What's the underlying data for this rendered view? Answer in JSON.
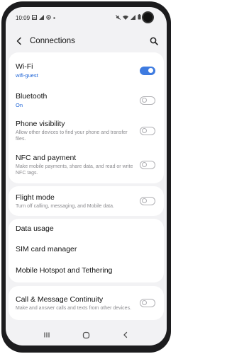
{
  "status_bar": {
    "time": "10:09",
    "left_icons": [
      "image-notification-icon",
      "signal-strength-icon",
      "settings-notification-icon",
      "more-notifications-icon"
    ],
    "right_icons": [
      "mute-icon",
      "wifi-icon",
      "signal-strength-icon",
      "battery-icon"
    ]
  },
  "header": {
    "title": "Connections"
  },
  "groups": [
    {
      "items": [
        {
          "title": "Wi-Fi",
          "status": "wifi-guest",
          "toggle": true,
          "toggle_on": true
        },
        {
          "title": "Bluetooth",
          "status": "On",
          "toggle": true,
          "toggle_on": false
        },
        {
          "title": "Phone visibility",
          "subtitle": "Allow other devices to find your phone and transfer files.",
          "toggle": true,
          "toggle_on": false
        },
        {
          "title": "NFC and payment",
          "subtitle": "Make mobile payments, share data, and read or write NFC tags.",
          "toggle": true,
          "toggle_on": false
        }
      ]
    },
    {
      "items": [
        {
          "title": "Flight mode",
          "subtitle": "Turn off calling, messaging, and Mobile data.",
          "toggle": true,
          "toggle_on": false
        }
      ]
    },
    {
      "items": [
        {
          "title": "Data usage"
        },
        {
          "title": "SIM card manager"
        },
        {
          "title": "Mobile Hotspot and Tethering"
        }
      ]
    },
    {
      "items": [
        {
          "title": "Call & Message Continuity",
          "subtitle": "Make and answer calls and texts from other devices.",
          "toggle": true,
          "toggle_on": false
        }
      ]
    }
  ],
  "nav_bar": {
    "icons": [
      "recent-apps-icon",
      "home-icon",
      "back-icon"
    ]
  },
  "colors": {
    "accent": "#3e7be0",
    "status_text": "#1b62d6",
    "background": "#f2f2f4"
  }
}
